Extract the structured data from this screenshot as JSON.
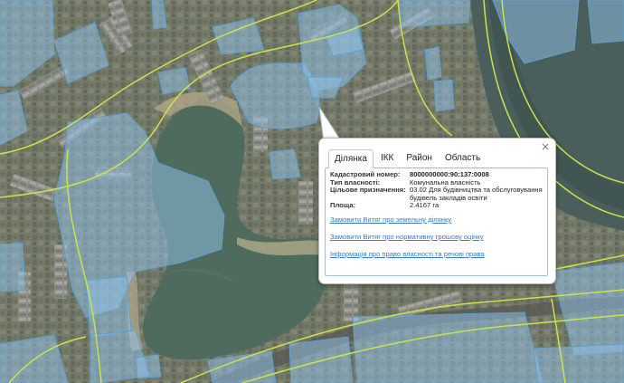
{
  "popup": {
    "close_label": "×",
    "tabs": [
      {
        "label": "Ділянка",
        "active": true
      },
      {
        "label": "ІКК"
      },
      {
        "label": "Район"
      },
      {
        "label": "Область"
      }
    ],
    "fields": {
      "cadastral_label": "Кадастровий номер:",
      "cadastral_value": "8000000000:90:137:0008",
      "ownership_label": "Тип власності:",
      "ownership_value": "Комунальна власність",
      "purpose_label": "Цільове призначення:",
      "purpose_value": "03.02 Для будівництва та обслуговування будівель закладів освіти",
      "area_label": "Площа:",
      "area_value": "2.4167 га"
    },
    "links": [
      "Замовити Витяг про земельну ділянку",
      "Замовити Витяг про нормативну грошову оцінку",
      "Інформація про право власності та речові права"
    ]
  },
  "colors": {
    "parcel_fill": "#8fc3eb",
    "parcel_stroke": "#5e9fd1",
    "boundary_line": "#cde24a",
    "water": "#4d6a5a",
    "link": "#3b7bc2"
  }
}
